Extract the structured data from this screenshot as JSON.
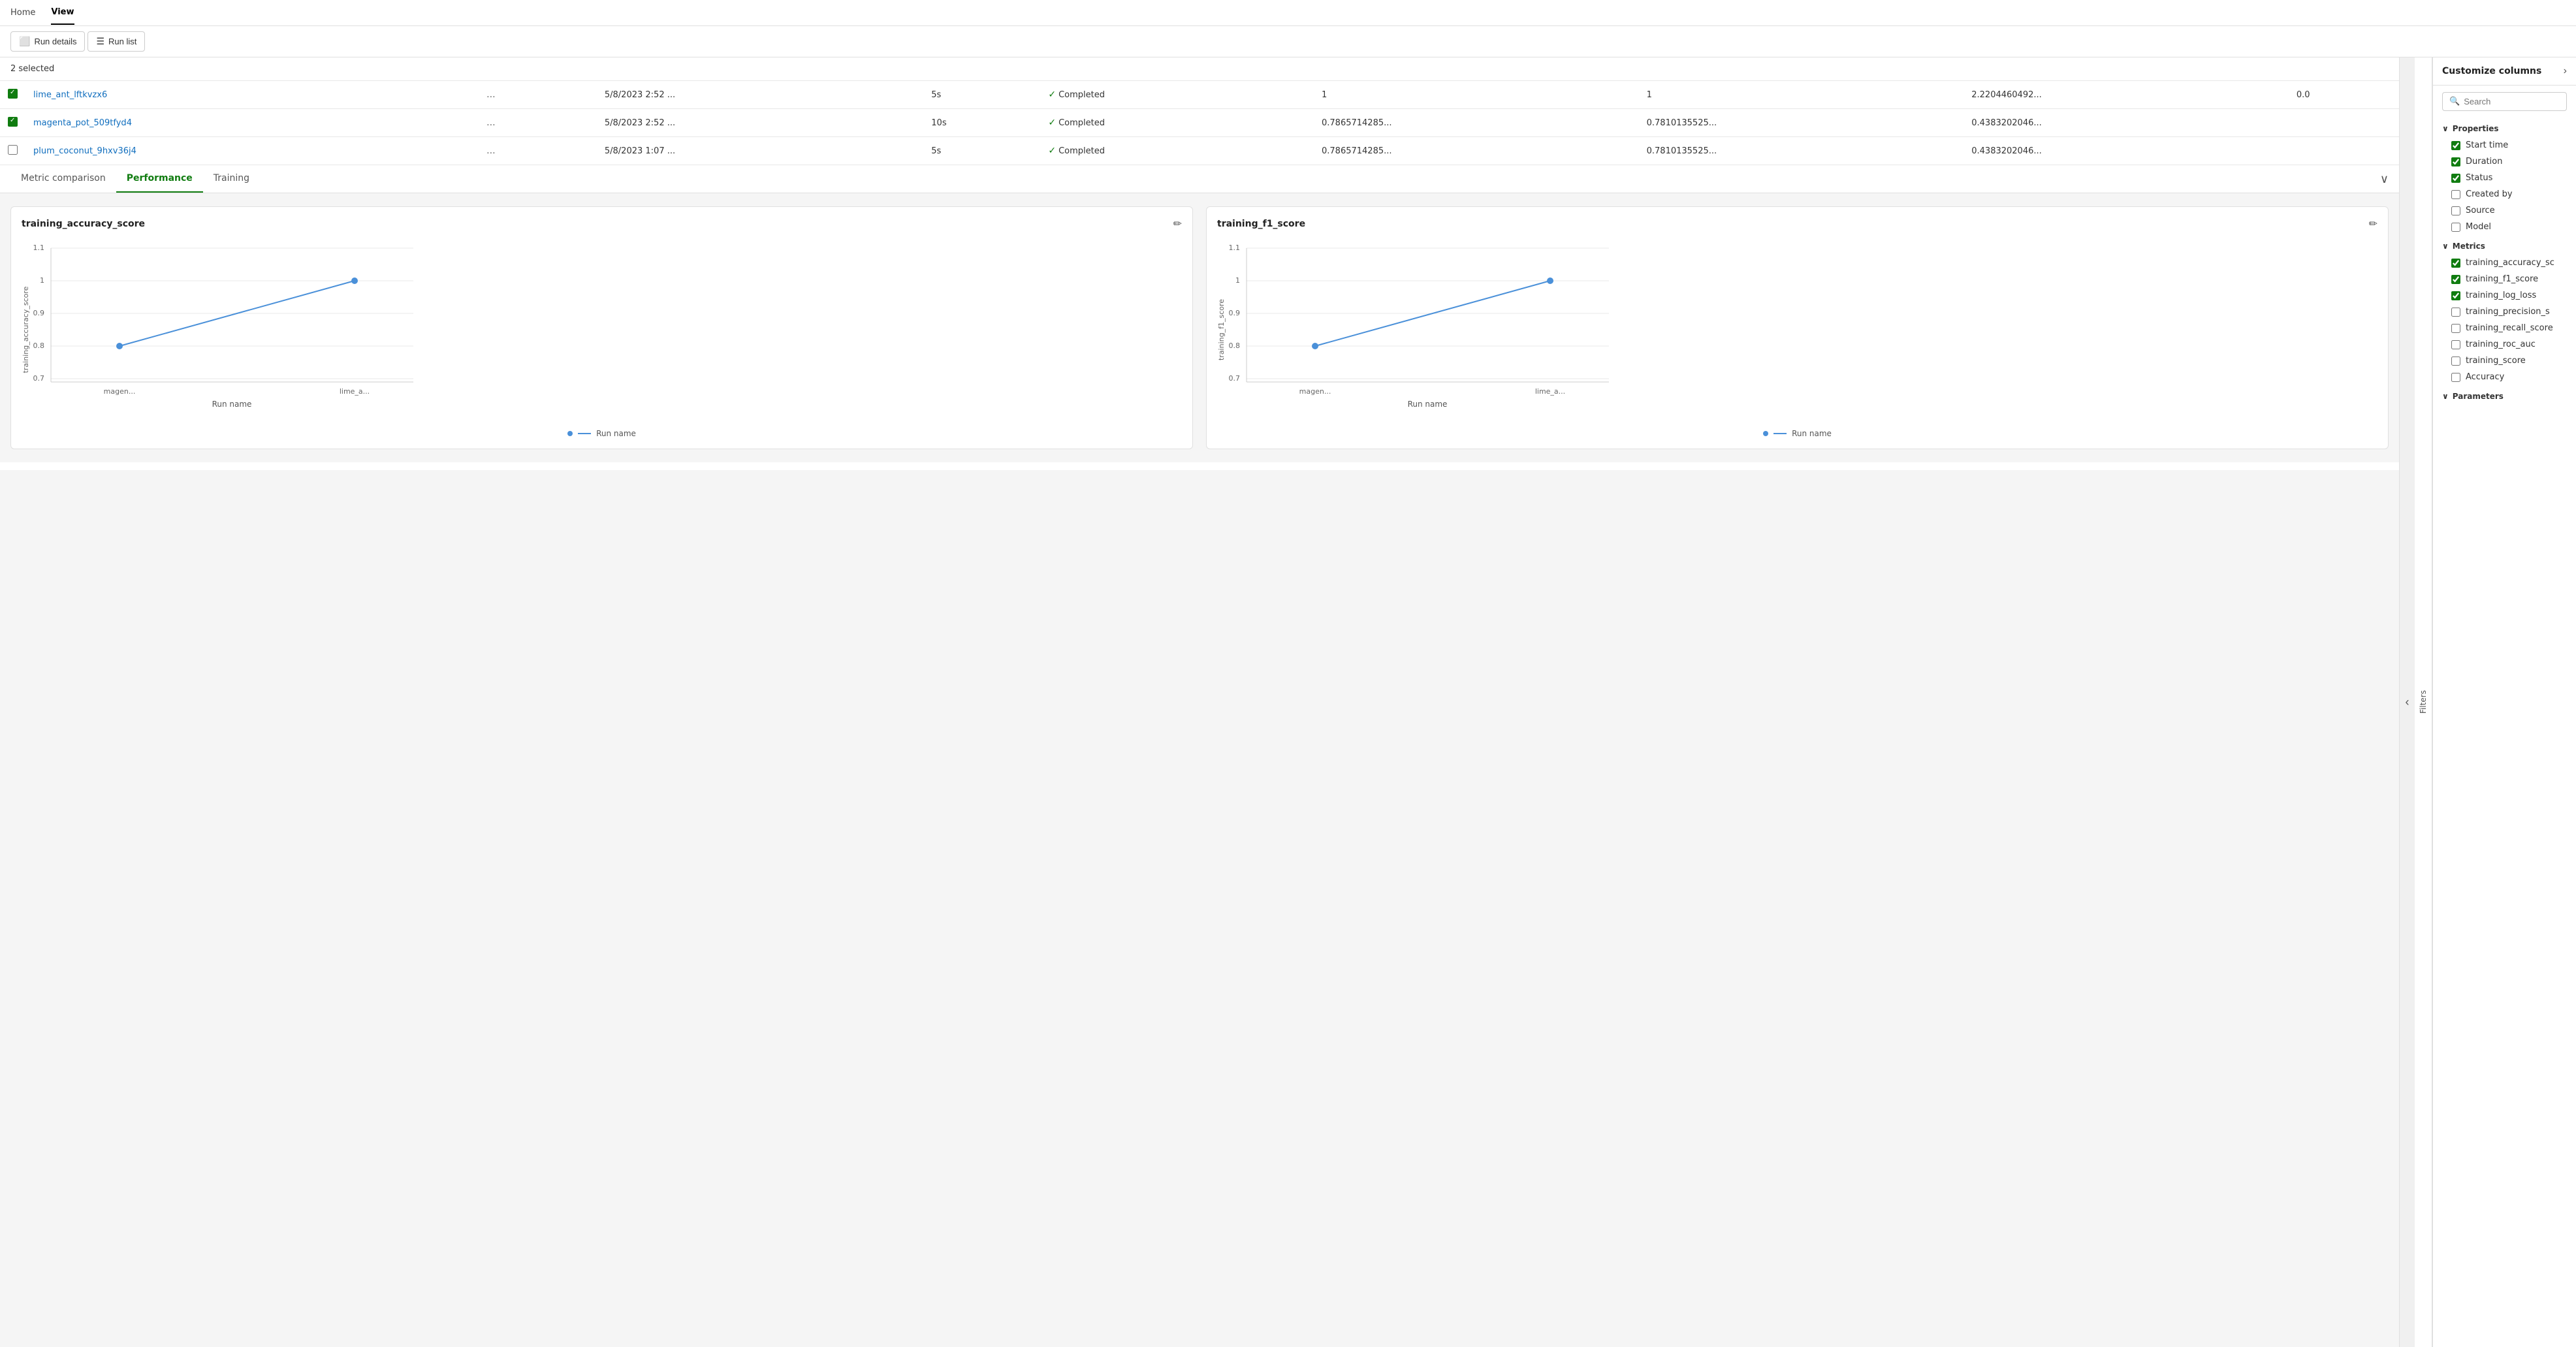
{
  "nav": {
    "items": [
      {
        "label": "Home",
        "active": false
      },
      {
        "label": "View",
        "active": true
      }
    ]
  },
  "toolbar": {
    "run_details_label": "Run details",
    "run_list_label": "Run list"
  },
  "table": {
    "selected_count": "2 selected",
    "rows": [
      {
        "checked": true,
        "name": "lime_ant_lftkvzx6",
        "ellipsis": "...",
        "date": "5/8/2023 2:52 ...",
        "duration": "5s",
        "status": "Completed",
        "col1": "1",
        "col2": "1",
        "col3": "2.2204460492...",
        "col4": "0.0"
      },
      {
        "checked": true,
        "name": "magenta_pot_509tfyd4",
        "ellipsis": "...",
        "date": "5/8/2023 2:52 ...",
        "duration": "10s",
        "status": "Completed",
        "col1": "0.7865714285...",
        "col2": "0.7810135525...",
        "col3": "0.4383202046...",
        "col4": ""
      },
      {
        "checked": false,
        "name": "plum_coconut_9hxv36j4",
        "ellipsis": "...",
        "date": "5/8/2023 1:07 ...",
        "duration": "5s",
        "status": "Completed",
        "col1": "0.7865714285...",
        "col2": "0.7810135525...",
        "col3": "0.4383202046...",
        "col4": ""
      }
    ]
  },
  "tabs": {
    "items": [
      {
        "label": "Metric comparison",
        "active": false
      },
      {
        "label": "Performance",
        "active": true
      },
      {
        "label": "Training",
        "active": false
      }
    ]
  },
  "charts": {
    "chart1": {
      "title": "training_accuracy_score",
      "y_axis_label": "training_accuracy_score",
      "x_axis_label": "Run name",
      "legend": "Run name",
      "y_ticks": [
        "1.1",
        "1",
        "0.9",
        "0.8",
        "0.7"
      ],
      "x_labels": [
        "magen...",
        "lime_a..."
      ],
      "points": [
        {
          "x": 120,
          "y": 195,
          "label": "magen..."
        },
        {
          "x": 510,
          "y": 65,
          "label": "lime_a..."
        }
      ]
    },
    "chart2": {
      "title": "training_f1_score",
      "y_axis_label": "training_f1_score",
      "x_axis_label": "Run name",
      "legend": "Run name",
      "y_ticks": [
        "1.1",
        "1",
        "0.9",
        "0.8",
        "0.7"
      ],
      "x_labels": [
        "magen...",
        "lime_a..."
      ],
      "points": [
        {
          "x": 120,
          "y": 195,
          "label": "magen..."
        },
        {
          "x": 510,
          "y": 65,
          "label": "lime_a..."
        }
      ]
    }
  },
  "right_panel": {
    "title": "Customize columns",
    "search_placeholder": "Search",
    "sections": {
      "properties": {
        "label": "Properties",
        "items": [
          {
            "label": "Start time",
            "checked": true
          },
          {
            "label": "Duration",
            "checked": true
          },
          {
            "label": "Status",
            "checked": true
          },
          {
            "label": "Created by",
            "checked": false
          },
          {
            "label": "Source",
            "checked": false
          },
          {
            "label": "Model",
            "checked": false
          }
        ]
      },
      "metrics": {
        "label": "Metrics",
        "items": [
          {
            "label": "training_accuracy_sc",
            "checked": true
          },
          {
            "label": "training_f1_score",
            "checked": true
          },
          {
            "label": "training_log_loss",
            "checked": true
          },
          {
            "label": "training_precision_s",
            "checked": false
          },
          {
            "label": "training_recall_score",
            "checked": false
          },
          {
            "label": "training_roc_auc",
            "checked": false
          },
          {
            "label": "training_score",
            "checked": false
          },
          {
            "label": "Accuracy",
            "checked": false
          }
        ]
      },
      "parameters": {
        "label": "Parameters",
        "items": []
      }
    }
  },
  "filters_tab": "Filters"
}
